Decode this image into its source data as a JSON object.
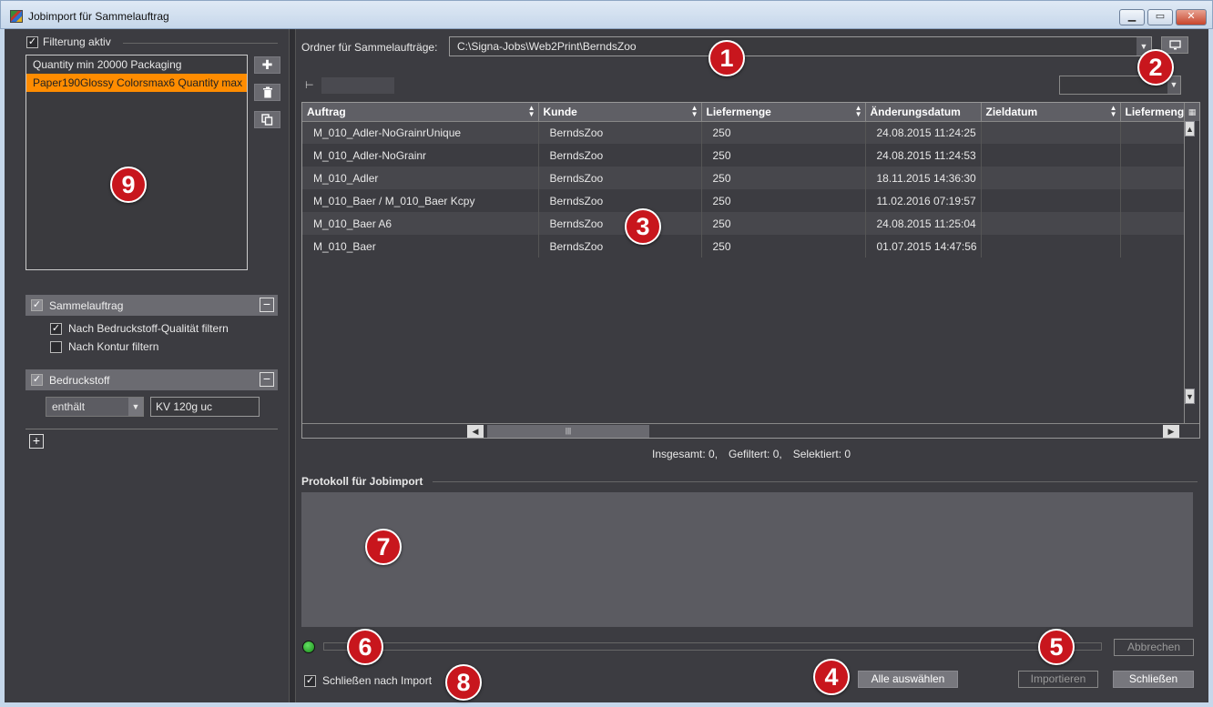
{
  "window": {
    "title": "Jobimport für Sammelauftrag",
    "min_glyph": "▁",
    "max_glyph": "▭",
    "close_glyph": "✕"
  },
  "left": {
    "filter_active_label": "Filterung aktiv",
    "filter_active_checked": true,
    "filters": [
      {
        "label": "Quantity min 20000 Packaging",
        "selected": false
      },
      {
        "label": "Paper190Glossy Colorsmax6 Quantity max",
        "selected": true
      }
    ],
    "sections": [
      {
        "title": "Sammelauftrag",
        "options": [
          {
            "label": "Nach Bedruckstoff-Qualität filtern",
            "checked": true
          },
          {
            "label": "Nach Kontur filtern",
            "checked": false
          }
        ]
      },
      {
        "title": "Bedruckstoff",
        "operator": "enthält",
        "value": "KV 120g uc"
      }
    ]
  },
  "right": {
    "folder_label": "Ordner für Sammelaufträge:",
    "folder_path": "C:\\Signa-Jobs\\Web2Print\\BerndsZoo",
    "table": {
      "columns": [
        "Auftrag",
        "Kunde",
        "Liefermenge",
        "Änderungsdatum",
        "Zieldatum",
        "Liefermenge"
      ],
      "rows": [
        [
          "M_010_Adler-NoGrainrUnique",
          "BerndsZoo",
          "250",
          "24.08.2015 11:24:25",
          "",
          ""
        ],
        [
          "M_010_Adler-NoGrainr",
          "BerndsZoo",
          "250",
          "24.08.2015 11:24:53",
          "",
          ""
        ],
        [
          "M_010_Adler",
          "BerndsZoo",
          "250",
          "18.11.2015 14:36:30",
          "",
          ""
        ],
        [
          "M_010_Baer / M_010_Baer Kcpy",
          "BerndsZoo",
          "250",
          "11.02.2016 07:19:57",
          "",
          ""
        ],
        [
          "M_010_Baer A6",
          "BerndsZoo",
          "250",
          "24.08.2015 11:25:04",
          "",
          ""
        ],
        [
          "M_010_Baer",
          "BerndsZoo",
          "250",
          "01.07.2015 14:47:56",
          "",
          ""
        ]
      ]
    },
    "counts": {
      "total": "Insgesamt: 0,",
      "filtered": "Gefiltert: 0,",
      "selected": "Selektiert: 0"
    },
    "protocol_label": "Protokoll für Jobimport",
    "buttons": {
      "cancel": "Abbrechen",
      "select_all": "Alle auswählen",
      "import": "Importieren",
      "close": "Schließen"
    },
    "close_after_import_label": "Schließen nach Import",
    "close_after_import_checked": true
  },
  "callouts": [
    "1",
    "2",
    "3",
    "4",
    "5",
    "6",
    "7",
    "8",
    "9"
  ],
  "colors": {
    "background": "#3c3c41",
    "selection": "#ff8c00",
    "callout": "#c8161d",
    "status_ok": "#2fb52f"
  }
}
